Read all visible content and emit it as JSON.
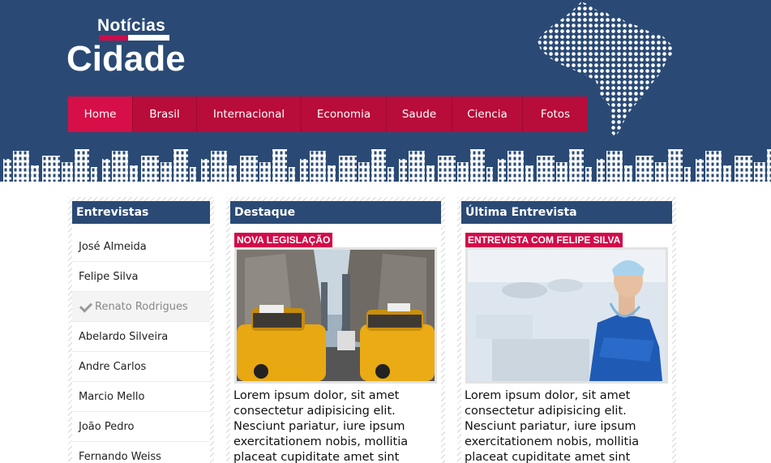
{
  "header": {
    "logo_small": "Notícias",
    "logo_big": "Cidade",
    "brand_color": "#2a4a75",
    "accent_color": "#d10a4a"
  },
  "nav": {
    "items": [
      {
        "label": "Home"
      },
      {
        "label": "Brasil"
      },
      {
        "label": "Internacional"
      },
      {
        "label": "Economia"
      },
      {
        "label": "Saude"
      },
      {
        "label": "Ciencia"
      },
      {
        "label": "Fotos"
      }
    ],
    "active": "Home"
  },
  "entrevistas": {
    "title": "Entrevistas",
    "items": [
      "José Almeida",
      "Felipe Silva",
      "Renato Rodrigues",
      "Abelardo Silveira",
      "Andre Carlos",
      "Marcio Mello",
      "João Pedro",
      "Fernando Weiss"
    ],
    "selected": "Renato Rodrigues"
  },
  "destaque": {
    "title": "Destaque",
    "tag": "NOVA LEGISLAÇÃO",
    "text": "Lorem ipsum dolor, sit amet consectetur adipisicing elit. Nesciunt pariatur, iure ipsum exercitationem nobis, mollitia placeat cupiditate amet sint"
  },
  "ultima": {
    "title": "Última Entrevista",
    "tag": "ENTREVISTA COM FELIPE SILVA",
    "text": "Lorem ipsum dolor, sit amet consectetur adipisicing elit. Nesciunt pariatur, iure ipsum exercitationem nobis, mollitia placeat cupiditate amet sint"
  }
}
